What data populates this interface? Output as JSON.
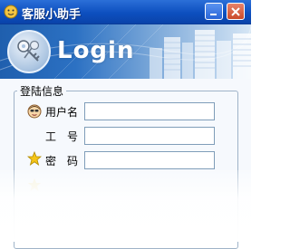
{
  "window": {
    "title": "客服小助手",
    "accent": "#0d4fbf"
  },
  "banner": {
    "login_text": "Login"
  },
  "form": {
    "group_title": "登陆信息",
    "fields": [
      {
        "label": "用户名",
        "value": "",
        "icon": "user-face-icon"
      },
      {
        "label": "工　号",
        "value": "",
        "icon": ""
      },
      {
        "label": "密　码",
        "value": "",
        "icon": "star-icon"
      }
    ]
  }
}
